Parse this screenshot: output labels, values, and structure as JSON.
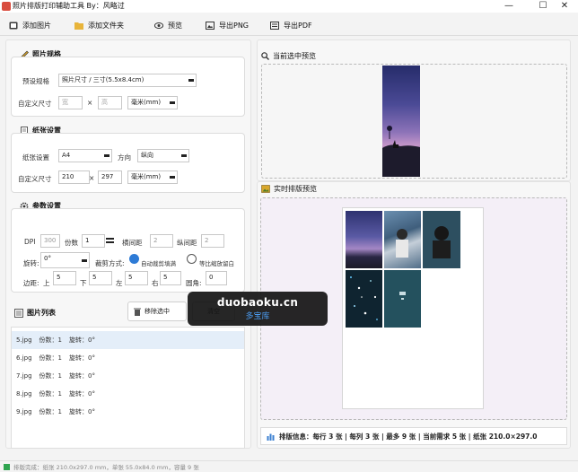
{
  "window": {
    "title": "照片排版打印辅助工具 By：风略过",
    "minimize": "—",
    "maximize": "☐",
    "close": "✕"
  },
  "toolbar": {
    "add_image": "添加图片",
    "add_folder": "添加文件夹",
    "preview": "预览",
    "export_png": "导出PNG",
    "export_pdf": "导出PDF"
  },
  "photo_spec": {
    "title": "照片规格",
    "preset_label": "预设规格",
    "preset_value": "照片尺寸 / 三寸(5.5x8.4cm)",
    "custom_label": "自定义尺寸",
    "width_placeholder": "宽",
    "times": "×",
    "height_placeholder": "高",
    "unit": "毫米(mm)"
  },
  "paper": {
    "title": "纸张设置",
    "paper_label": "纸张设置",
    "paper_value": "A4",
    "direction_label": "方向",
    "direction_value": "纵向",
    "custom_label": "自定义尺寸",
    "width": "210",
    "times": "×",
    "height": "297",
    "unit": "毫米(mm)"
  },
  "params": {
    "title": "参数设置",
    "dpi_label": "DPI",
    "dpi_value": "300",
    "copies_label": "份数",
    "copies_value": "1",
    "hgap_label": "横间距",
    "hgap_value": "2",
    "vgap_label": "纵间距",
    "vgap_value": "2",
    "rotate_label": "旋转:",
    "rotate_value": "0°",
    "crop_label": "裁剪方式:",
    "crop_auto": "自动裁剪填满",
    "crop_scale": "等比缩放留白",
    "margin_label": "边距:",
    "top_label": "上",
    "top_value": "5",
    "bottom_label": "下",
    "bottom_value": "5",
    "left_label": "左",
    "left_value": "5",
    "right_label": "右",
    "right_value": "5",
    "corner_label": "圆角:",
    "corner_value": "0"
  },
  "image_list": {
    "title": "图片列表",
    "remove_selected": "移除选中",
    "clear": "清空",
    "rows": [
      {
        "name": "5.jpg",
        "copies": "份数：1",
        "rotate": "旋转：0°"
      },
      {
        "name": "6.jpg",
        "copies": "份数：1",
        "rotate": "旋转：0°"
      },
      {
        "name": "7.jpg",
        "copies": "份数：1",
        "rotate": "旋转：0°"
      },
      {
        "name": "8.jpg",
        "copies": "份数：1",
        "rotate": "旋转：0°"
      },
      {
        "name": "9.jpg",
        "copies": "份数：1",
        "rotate": "旋转：0°"
      }
    ]
  },
  "current_preview": {
    "title": "当前选中预览"
  },
  "realtime_preview": {
    "title": "实时排版预览"
  },
  "layout_info": "排版信息：每行 3 张 | 每列 3 张 | 最多 9 张 | 当前需求 5 张 | 纸张 210.0×297.0",
  "status_bar": "排版完成：纸张 210.0x297.0 mm，单张 55.0x84.0 mm，容量 9 张",
  "watermark": {
    "line1": "duobaoku.cn",
    "line2": "多宝库"
  },
  "colors": {
    "accent": "#2e7bd6",
    "selected_row": "#e4eef9",
    "overlay": "#141414"
  }
}
